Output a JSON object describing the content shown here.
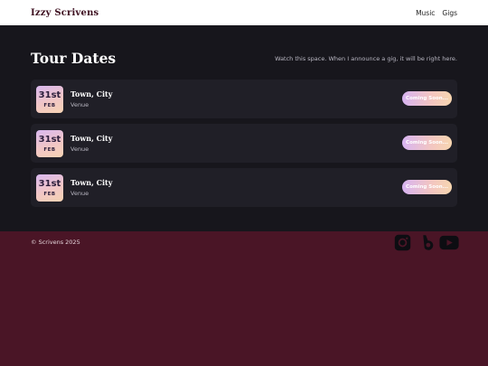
{
  "header": {
    "brand": "Izzy Scrivens",
    "nav": [
      {
        "label": "Music"
      },
      {
        "label": "Gigs"
      }
    ]
  },
  "main": {
    "title": "Tour Dates",
    "notice": "Watch this space. When I announce a gig, it will be right here.",
    "gigs": [
      {
        "day": "31st",
        "month": "FEB",
        "place": "Town, City",
        "venue": "Venue",
        "status": "Coming Soon..."
      },
      {
        "day": "31st",
        "month": "FEB",
        "place": "Town, City",
        "venue": "Venue",
        "status": "Coming Soon..."
      },
      {
        "day": "31st",
        "month": "FEB",
        "place": "Town, City",
        "venue": "Venue",
        "status": "Coming Soon..."
      }
    ]
  },
  "footer": {
    "copyright": "© Scrivens 2025",
    "socials": [
      "instagram-icon",
      "bandlab-icon",
      "youtube-icon"
    ]
  },
  "colors": {
    "header_bg": "#ffffff",
    "main_bg": "#17161c",
    "card_bg": "#201f27",
    "footer_bg": "#4a1526",
    "accent_gradient_start": "#d7b4f2",
    "accent_gradient_end": "#f7d6b0"
  }
}
